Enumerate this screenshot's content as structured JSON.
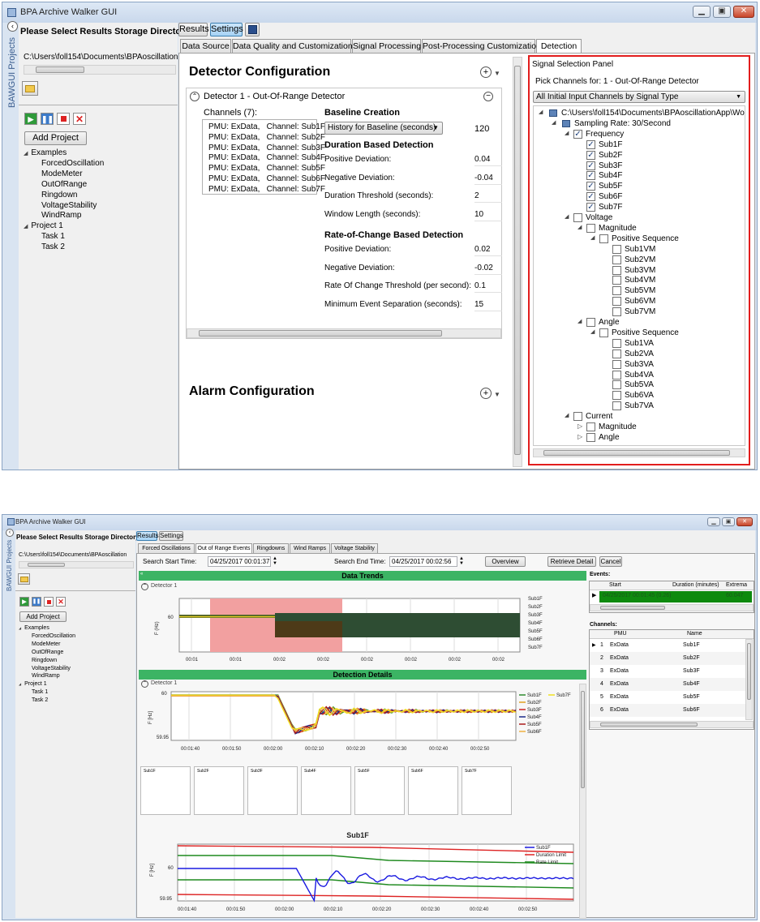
{
  "top": {
    "title": "BPA Archive Walker GUI",
    "side_tab": "BAWGUI Projects",
    "storage_label": "Please Select Results Storage Directory",
    "storage_path": "C:\\Users\\foll154\\Documents\\BPAoscillation",
    "add_project": "Add Project",
    "tree": [
      {
        "label": "Examples",
        "level": 0
      },
      {
        "label": "ForcedOscillation",
        "level": 1
      },
      {
        "label": "ModeMeter",
        "level": 1
      },
      {
        "label": "OutOfRange",
        "level": 1
      },
      {
        "label": "Ringdown",
        "level": 1
      },
      {
        "label": "VoltageStability",
        "level": 1
      },
      {
        "label": "WindRamp",
        "level": 1
      },
      {
        "label": "Project 1",
        "level": 0
      },
      {
        "label": "Task 1",
        "level": 1
      },
      {
        "label": "Task 2",
        "level": 1
      }
    ],
    "toolbar": {
      "results": "Results",
      "settings": "Settings"
    },
    "tabs": [
      "Data Source",
      "Data Quality and Customization",
      "Signal Processing",
      "Post-Processing Customization",
      "Detection"
    ],
    "detector_config": "Detector Configuration",
    "detector_name": "Detector 1 - Out-Of-Range Detector",
    "channels_label": "Channels (7):",
    "channels": [
      "PMU: ExData,   Channel: Sub1F",
      "PMU: ExData,   Channel: Sub2F",
      "PMU: ExData,   Channel: Sub3F",
      "PMU: ExData,   Channel: Sub4F",
      "PMU: ExData,   Channel: Sub5F",
      "PMU: ExData,   Channel: Sub6F",
      "PMU: ExData,   Channel: Sub7F"
    ],
    "baseline_title": "Baseline Creation",
    "baseline_select": "History for Baseline (seconds)",
    "baseline_value": "120",
    "duration_title": "Duration Based Detection",
    "duration_rows": [
      {
        "label": "Positive Deviation:",
        "value": "0.04"
      },
      {
        "label": "Negative Deviation:",
        "value": "-0.04"
      },
      {
        "label": "Duration Threshold (seconds):",
        "value": "2"
      },
      {
        "label": "Window Length (seconds):",
        "value": "10"
      }
    ],
    "roc_title": "Rate-of-Change Based Detection",
    "roc_rows": [
      {
        "label": "Positive Deviation:",
        "value": "0.02"
      },
      {
        "label": "Negative Deviation:",
        "value": "-0.02"
      },
      {
        "label": "Rate Of Change Threshold (per second):",
        "value": "0.1"
      },
      {
        "label": "Minimum Event Separation (seconds):",
        "value": "15"
      }
    ],
    "alarm_config": "Alarm Configuration",
    "signal_panel": {
      "title": "Signal Selection Panel",
      "pick_label": "Pick Channels for: 1 - Out-Of-Range Detector",
      "dropdown": "All Initial Input Channels by Signal Type",
      "root_path": "C:\\Users\\foll154\\Documents\\BPAoscillationApp\\Work",
      "sampling": "Sampling Rate: 30/Second",
      "frequency": "Frequency",
      "freq_items": [
        "Sub1F",
        "Sub2F",
        "Sub3F",
        "Sub4F",
        "Sub5F",
        "Sub6F",
        "Sub7F"
      ],
      "voltage": "Voltage",
      "magnitude": "Magnitude",
      "positive_sequence": "Positive Sequence",
      "vm_items": [
        "Sub1VM",
        "Sub2VM",
        "Sub3VM",
        "Sub4VM",
        "Sub5VM",
        "Sub6VM",
        "Sub7VM"
      ],
      "angle": "Angle",
      "va_items": [
        "Sub1VA",
        "Sub2VA",
        "Sub3VA",
        "Sub4VA",
        "Sub5VA",
        "Sub6VA",
        "Sub7VA"
      ],
      "current": "Current",
      "cur_magnitude": "Magnitude",
      "cur_angle": "Angle"
    }
  },
  "bottom": {
    "title": "BPA Archive Walker GUI",
    "side_tab": "BAWGUI Projects",
    "storage_label": "Please Select Results Storage Directory",
    "storage_path": "C:\\Users\\foll154\\Documents\\BPAoscillation",
    "add_project": "Add Project",
    "tree": [
      {
        "label": "Examples",
        "level": 0
      },
      {
        "label": "ForcedOscillation",
        "level": 1
      },
      {
        "label": "ModeMeter",
        "level": 1
      },
      {
        "label": "OutOfRange",
        "level": 1
      },
      {
        "label": "Ringdown",
        "level": 1
      },
      {
        "label": "VoltageStability",
        "level": 1
      },
      {
        "label": "WindRamp",
        "level": 1
      },
      {
        "label": "Project 1",
        "level": 0
      },
      {
        "label": "Task 1",
        "level": 1
      },
      {
        "label": "Task 2",
        "level": 1
      }
    ],
    "toolbar": {
      "results": "Results",
      "settings": "Settings"
    },
    "tabs": [
      "Forced Oscillations",
      "Out of Range Events",
      "Ringdowns",
      "Wind Ramps",
      "Voltage Stability"
    ],
    "search_start_label": "Search Start Time:",
    "search_start": "04/25/2017 00:01:37",
    "search_end_label": "Search End Time:",
    "search_end": "04/25/2017 00:02:56",
    "overview": "Overview",
    "retrieve": "Retrieve Detail",
    "cancel": "Cancel",
    "data_trends": "Data Trends",
    "detector": "Detector 1",
    "detection_details": "Detection Details",
    "events_label": "Events:",
    "events_cols": [
      "Start",
      "Duration (minutes)",
      "Extrema"
    ],
    "events_row": [
      "04/25/2017 00:01:45 (0.26)",
      "",
      "60.047"
    ],
    "channels_label": "Channels:",
    "channel_cols": [
      "PMU",
      "Name"
    ],
    "channel_rows": [
      {
        "n": "1",
        "pmu": "ExData",
        "name": "Sub1F"
      },
      {
        "n": "2",
        "pmu": "ExData",
        "name": "Sub2F"
      },
      {
        "n": "3",
        "pmu": "ExData",
        "name": "Sub3F"
      },
      {
        "n": "4",
        "pmu": "ExData",
        "name": "Sub4F"
      },
      {
        "n": "5",
        "pmu": "ExData",
        "name": "Sub5F"
      },
      {
        "n": "6",
        "pmu": "ExData",
        "name": "Sub6F"
      }
    ],
    "thumbs": [
      "Sub1F",
      "Sub2F",
      "Sub3F",
      "Sub4F",
      "Sub5F",
      "Sub6F",
      "Sub7F"
    ]
  },
  "chart_data": [
    {
      "type": "line",
      "title": "",
      "ylabel": "F (Hz)",
      "x": [
        "00:01",
        "00:01",
        "00:02",
        "00:02",
        "00:02",
        "00:02",
        "00:02",
        "00:02"
      ],
      "yticks": [
        "60"
      ],
      "legend": [
        "Sub1F",
        "Sub2F",
        "Sub3F",
        "Sub4F",
        "Sub5F",
        "Sub6F",
        "Sub7F"
      ],
      "colors": {
        "band": "#2e4d33",
        "alarm": "#f2a0a0",
        "before": "#4d3a18"
      }
    },
    {
      "type": "line",
      "title": "",
      "ylabel": "F [Hz]",
      "x": [
        "00:01:40",
        "00:01:50",
        "00:02:00",
        "00:02:10",
        "00:02:20",
        "00:02:30",
        "00:02:40",
        "00:02:50"
      ],
      "yticks": [
        "60",
        "59.95"
      ],
      "legend": [
        "Sub1F",
        "Sub2F",
        "Sub3F",
        "Sub4F",
        "Sub5F",
        "Sub6F",
        "Sub7F"
      ],
      "series_colors": [
        "#2f8a2f",
        "#e0a020",
        "#cc2222",
        "#1a2a8a",
        "#aa1a1a",
        "#f0b040",
        "#f0e020"
      ]
    },
    {
      "type": "line",
      "title": "Sub1F",
      "ylabel": "F [Hz]",
      "x": [
        "00:01:40",
        "00:01:50",
        "00:02:00",
        "00:02:10",
        "00:02:20",
        "00:02:30",
        "00:02:40",
        "00:02:50"
      ],
      "yticks": [
        "60",
        "59.95"
      ],
      "series": [
        {
          "name": "Sub1F",
          "color": "#1a1ae0"
        },
        {
          "name": "Duration Limit",
          "color": "#dd2222"
        },
        {
          "name": "Rate Limit",
          "color": "#1f8a1f"
        }
      ]
    }
  ]
}
